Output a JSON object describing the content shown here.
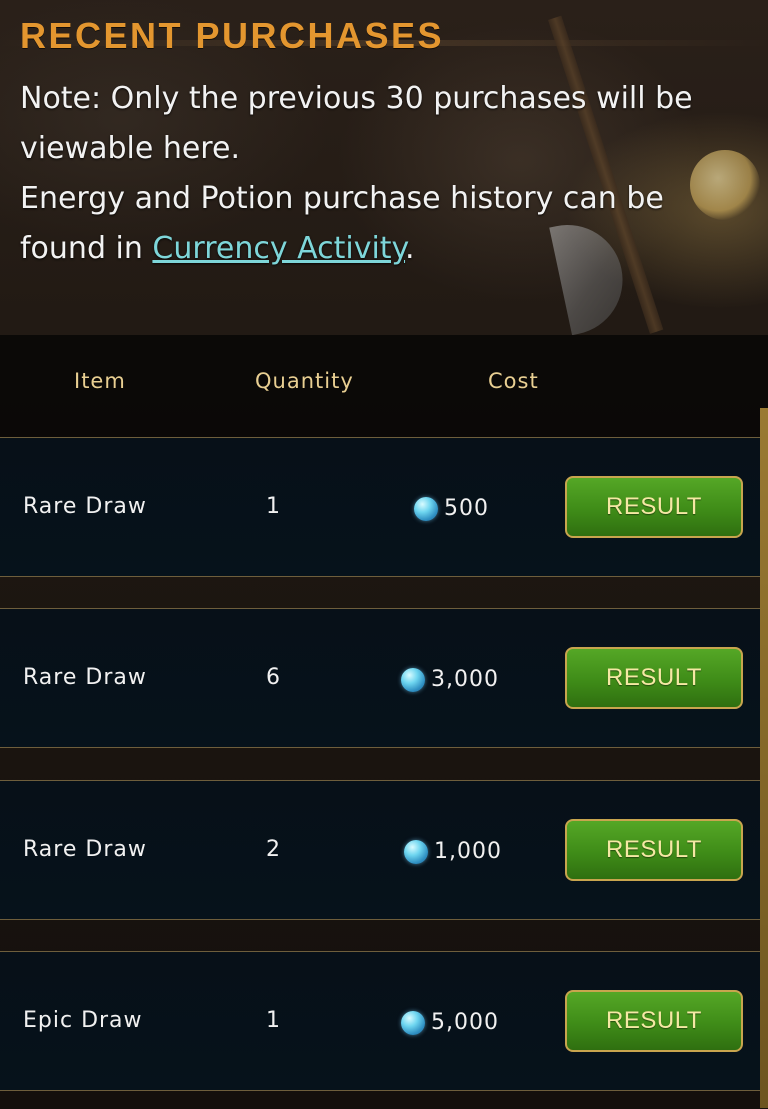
{
  "header": {
    "title": "RECENT PURCHASES",
    "note_line1": "Note: Only the previous 30 purchases will be viewable here.",
    "note_line2_prefix": "Energy and Potion purchase history can be found in ",
    "note_link": "Currency Activity",
    "note_line2_suffix": "."
  },
  "table": {
    "columns": {
      "item": "Item",
      "quantity": "Quantity",
      "cost": "Cost"
    },
    "rows": [
      {
        "item": "Rare Draw",
        "quantity": "1",
        "cost": "500",
        "currency_icon": "gem-icon",
        "action": "RESULT"
      },
      {
        "item": "Rare Draw",
        "quantity": "6",
        "cost": "3,000",
        "currency_icon": "gem-icon",
        "action": "RESULT"
      },
      {
        "item": "Rare Draw",
        "quantity": "2",
        "cost": "1,000",
        "currency_icon": "gem-icon",
        "action": "RESULT"
      },
      {
        "item": "Epic Draw",
        "quantity": "1",
        "cost": "5,000",
        "currency_icon": "gem-icon",
        "action": "RESULT"
      }
    ]
  },
  "colors": {
    "title": "#e3962f",
    "link": "#7ed6d9",
    "column_header": "#e9cf92",
    "button_green": "#3f8c18",
    "button_border": "#c8a54e"
  }
}
